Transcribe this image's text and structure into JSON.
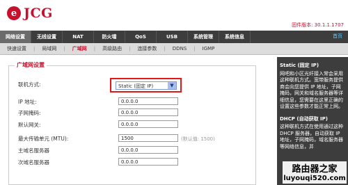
{
  "brand": {
    "logo_letter": "e",
    "name": "JCG"
  },
  "firmware": "固件版本: 30.1.1.1707",
  "nav": {
    "items": [
      "网络设置",
      "无线设置",
      "NAT",
      "防火墙",
      "QoS",
      "USB",
      "系统管理",
      "系统信息"
    ],
    "active_index": 0,
    "home": "首页"
  },
  "subnav": {
    "items": [
      "快速设置",
      "局域网",
      "广域网",
      "高级路由",
      "连接参数",
      "DDNS",
      "IGMP"
    ],
    "active_index": 2
  },
  "wan": {
    "section_title": "广域网设置",
    "connection_type_label": "联机方式:",
    "connection_type_value": "Static (固定 IP)",
    "ip_label": "IP 地址:",
    "ip_value": "0.0.0.0",
    "mask_label": "子网掩码:",
    "mask_value": "0.0.0.0",
    "gateway_label": "默认网关:",
    "gateway_value": "0.0.0.0",
    "mtu_label": "最大传输单元 (MTU):",
    "mtu_value": "1500",
    "mtu_hint": "(默认值: 1500)",
    "dns1_label": "主域名服务器",
    "dns1_value": "0.0.0.0",
    "dns2_label": "次域名服务器",
    "dns2_value": "0.0.0.0"
  },
  "help": {
    "static_title": "Static (固定 IP)",
    "static_text": "网吧和小区光纤接入常会采用这种联机方式。宽带服务提供商会向您提供 IP 地址，子网掩码，网关和域名服务器等详细信息，您需要在这里正确的设置这些参数才能正常上网。",
    "dhcp_title": "DHCP (自动获取 IP)",
    "dhcp_text": "这种联机方式在使用通过这种 DHCP 服务器，自动获取 IP 地址，子网掩码，域名服务器等网络信息，并"
  },
  "watermark": {
    "line1": "路由器之家",
    "line2": "luyouqi520.com"
  },
  "colors": {
    "accent": "#c8102e",
    "nav_bg": "#3d3d3d",
    "highlight_border": "#e01818"
  }
}
